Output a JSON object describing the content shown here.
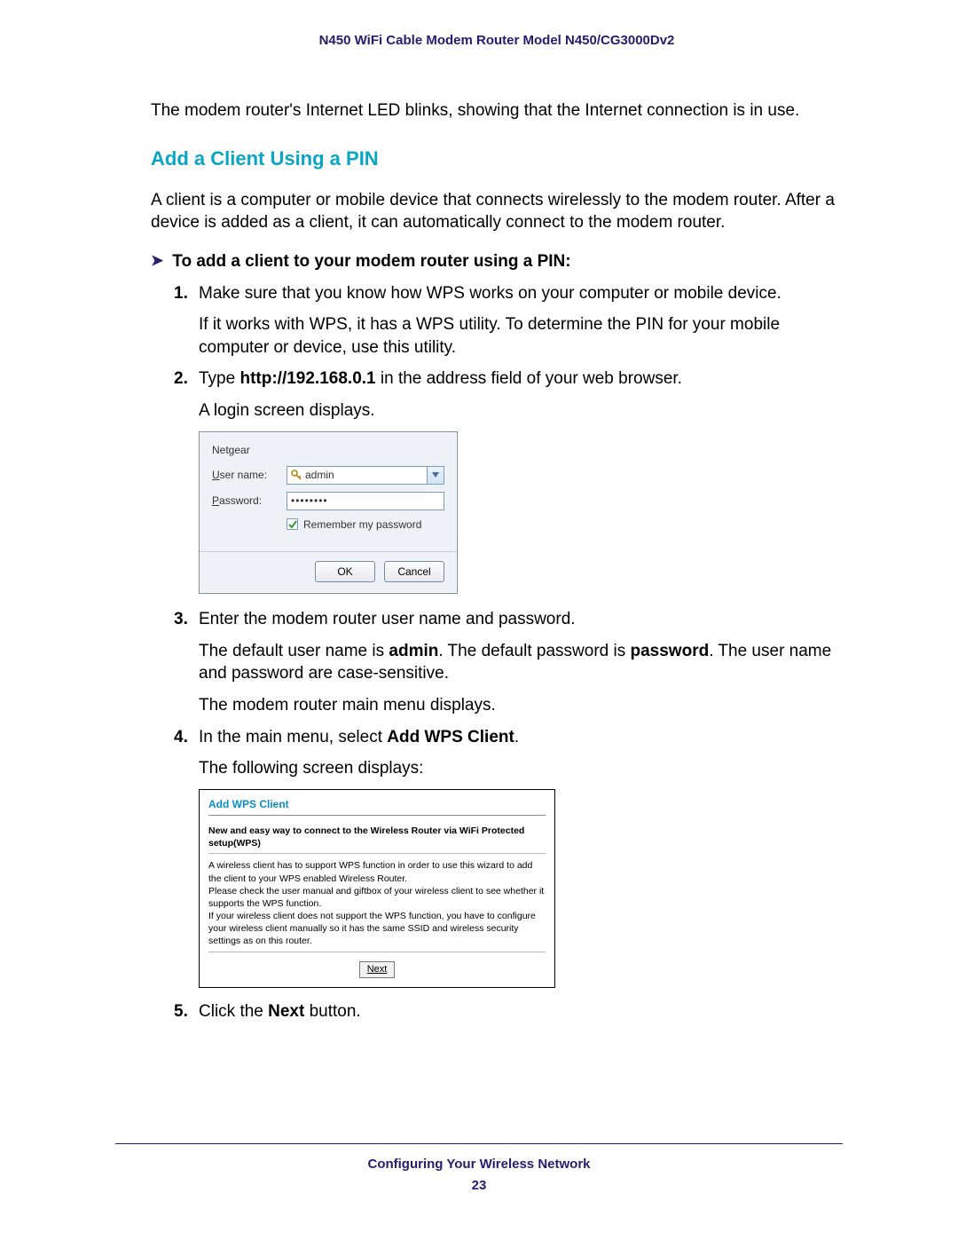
{
  "header": {
    "title": "N450 WiFi Cable Modem Router Model N450/CG3000Dv2"
  },
  "intro": "The modem router's Internet LED blinks, showing that the Internet connection is in use.",
  "section": {
    "heading": "Add a Client Using a PIN",
    "desc": "A client is a computer or mobile device that connects wirelessly to the modem router. After a device is added as a client, it can automatically connect to the modem router."
  },
  "task": "To add a client to your modem router using a PIN:",
  "steps": {
    "s1": {
      "num": "1.",
      "text": "Make sure that you know how WPS works on your computer or mobile device.",
      "text2": "If it works with WPS, it has a WPS utility. To determine the PIN for your mobile computer or device, use this utility."
    },
    "s2": {
      "num": "2.",
      "pre": "Type ",
      "url": "http://192.168.0.1",
      "post": " in the address field of your web browser.",
      "text2": "A login screen displays."
    },
    "s3": {
      "num": "3.",
      "text": "Enter the modem router user name and password.",
      "p2_a": "The default user name is ",
      "p2_b": "admin",
      "p2_c": ". The default password is ",
      "p2_d": "password",
      "p2_e": ". The user name and password are case-sensitive.",
      "p3": "The modem router main menu displays."
    },
    "s4": {
      "num": "4.",
      "pre": "In the main menu, select ",
      "menu": "Add WPS Client",
      "post": ".",
      "text2": "The following screen displays:"
    },
    "s5": {
      "num": "5.",
      "pre": "Click the ",
      "btn": "Next",
      "post": " button."
    }
  },
  "login": {
    "brand": "Netgear",
    "user_label_u": "U",
    "user_label_rest": "ser name:",
    "user_value": "admin",
    "pass_label_u": "P",
    "pass_label_rest": "assword:",
    "pass_value": "••••••••",
    "remember_u": "R",
    "remember_rest": "emember my password",
    "ok": "OK",
    "cancel": "Cancel"
  },
  "wps": {
    "title": "Add WPS Client",
    "sub": "New and easy way to connect to the Wireless Router via WiFi Protected setup(WPS)",
    "p1": "A wireless client has to support WPS function in order to use this wizard to add the client to your WPS enabled Wireless Router.",
    "p2": "Please check the user manual and giftbox of your wireless client to see whether it supports the WPS function.",
    "p3": "If your wireless client does not support the WPS function, you have to configure your wireless client manually so it has the same SSID and wireless security settings as on this router.",
    "next": "Next"
  },
  "footer": {
    "text": "Configuring Your Wireless Network",
    "page": "23"
  }
}
